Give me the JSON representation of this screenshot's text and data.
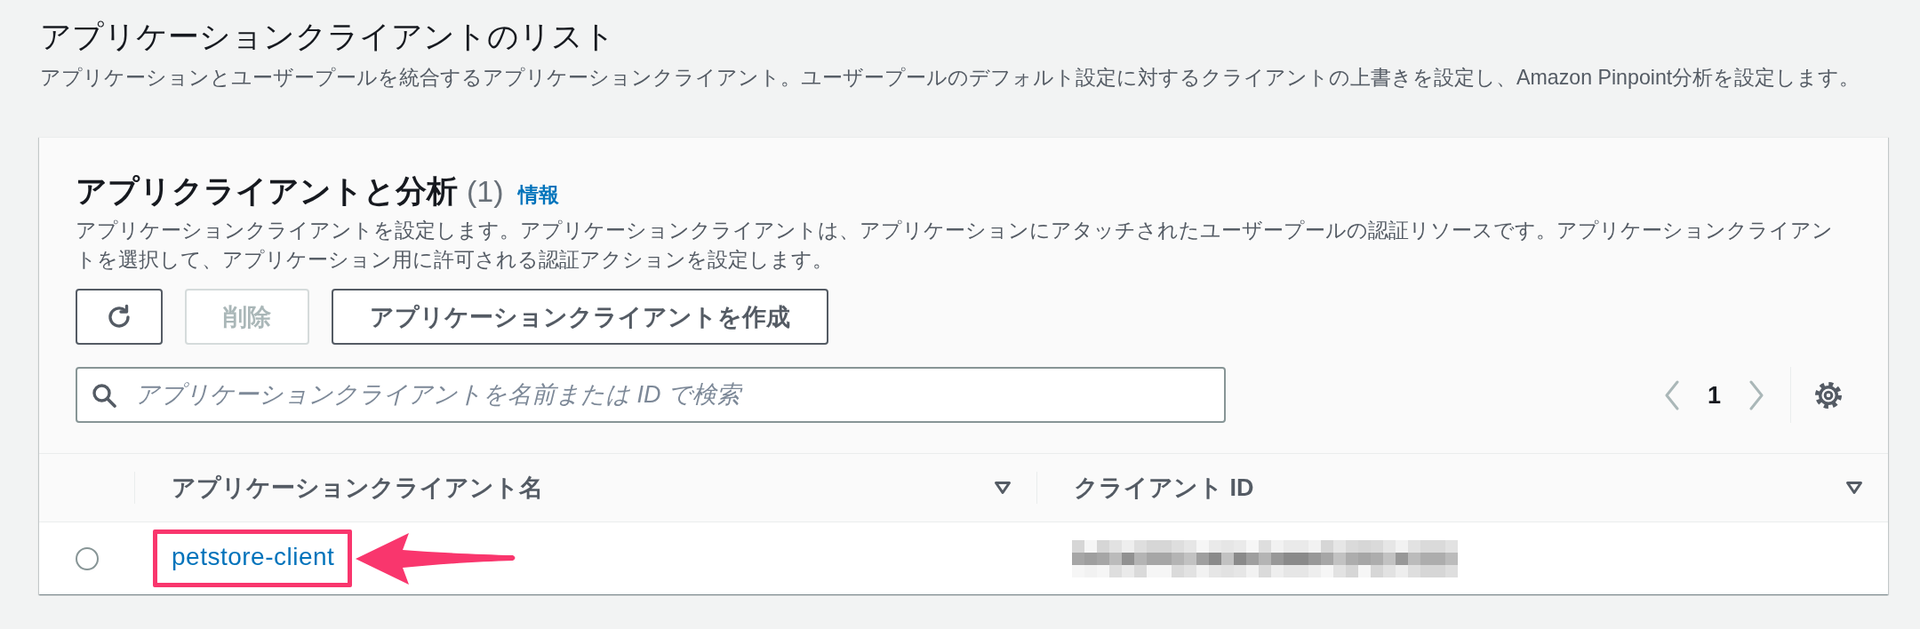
{
  "page": {
    "title": "アプリケーションクライアントのリスト",
    "description": "アプリケーションとユーザープールを統合するアプリケーションクライアント。ユーザープールのデフォルト設定に対するクライアントの上書きを設定し、Amazon Pinpoint分析を設定します。"
  },
  "panel": {
    "title": "アプリクライアントと分析",
    "count": "(1)",
    "info_link": "情報",
    "description": "アプリケーションクライアントを設定します。アプリケーションクライアントは、アプリケーションにアタッチされたユーザープールの認証リソースです。アプリケーションクライアントを選択して、アプリケーション用に許可される認証アクションを設定します。",
    "actions": [
      {
        "kind": "refresh",
        "disabled": false
      },
      {
        "kind": "delete",
        "label": "削除",
        "disabled": true
      },
      {
        "kind": "create",
        "label": "アプリケーションクライアントを作成",
        "disabled": false
      }
    ],
    "search": {
      "placeholder": "アプリケーションクライアントを名前または ID で検索"
    },
    "pagination": {
      "previous_disabled": true,
      "pages": [
        {
          "label": "1",
          "selected": true
        }
      ],
      "next_disabled": true
    },
    "table": {
      "columns": [
        {
          "label": "アプリケーションクライアント名",
          "sortable": true
        },
        {
          "label": "クライアント ID",
          "sortable": true
        }
      ],
      "rows": [
        {
          "selected": false,
          "name": "petstore-client",
          "highlighted": true,
          "client_id_redacted": true
        }
      ]
    }
  }
}
